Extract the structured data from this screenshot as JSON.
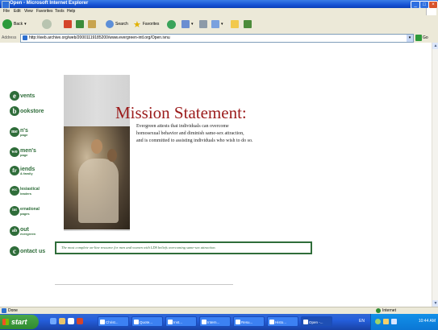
{
  "window": {
    "title": "Open - Microsoft Internet Explorer",
    "controls": [
      "minimize",
      "maximize",
      "close"
    ]
  },
  "menu": [
    "File",
    "Edit",
    "View",
    "Favorites",
    "Tools",
    "Help"
  ],
  "toolbar": {
    "back_label": "Back",
    "search_label": "Search",
    "favorites_label": "Favorites"
  },
  "address": {
    "label": "Address",
    "url": "http://web.archive.org/web/20001119185200/www.evergreen-intl.org/Open.ivnu",
    "go_label": "Go"
  },
  "nav": [
    {
      "initial": "e",
      "text": "vents",
      "sub": ""
    },
    {
      "initial": "b",
      "text": "ookstore",
      "sub": ""
    },
    {
      "initial": "me",
      "text": "n's",
      "sub": "page"
    },
    {
      "initial": "wo",
      "text": "men's",
      "sub": "page"
    },
    {
      "initial": "fr",
      "text": "iends",
      "sub": "& family"
    },
    {
      "initial": "ecc",
      "text": "lesiastical",
      "sub": "leaders"
    },
    {
      "initial": "int",
      "text": "ernational",
      "sub": "pages"
    },
    {
      "initial": "ab",
      "text": "out",
      "sub": "evergreen"
    },
    {
      "initial": "c",
      "text": "ontact us",
      "sub": ""
    }
  ],
  "main": {
    "heading": "Mission Statement:",
    "lines": [
      "Evergreen attests that individuals can overcome",
      "homosexual behavior and diminish same-sex attraction,",
      "and is committed to assisting individuals who wish to do so."
    ],
    "tagline": "The most complete on-line resource for men and women with LDS beliefs overcoming same-sex attraction."
  },
  "status": {
    "text": "Done",
    "zone": "Internet"
  },
  "taskbar": {
    "start": "start",
    "tasks": [
      "Christ...",
      "Quote...",
      "Inst...",
      "Intern...",
      "Resu...",
      "Histo...",
      "Open -..."
    ],
    "language": "EN",
    "clock": "10:44 AM"
  },
  "colors": {
    "nav_green": "#2f6d3a",
    "heading_red": "#9b1b1b",
    "xp_blue": "#245edb"
  }
}
